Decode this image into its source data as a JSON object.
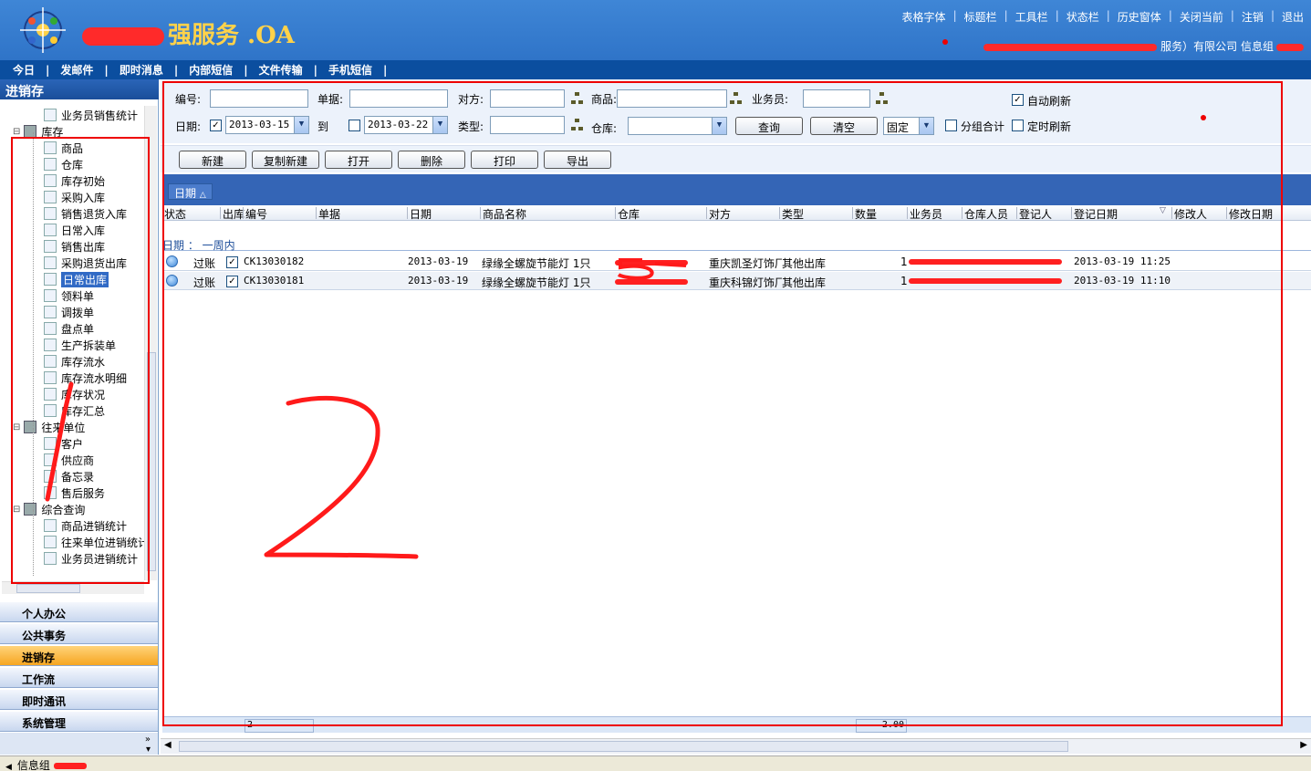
{
  "header": {
    "brand_text": "强服务 .OA",
    "top_links": [
      "表格字体",
      "标题栏",
      "工具栏",
      "状态栏",
      "历史窗体",
      "关闭当前",
      "注销",
      "退出"
    ],
    "company_text": "服务）有限公司",
    "user_group": "信息组"
  },
  "menu": [
    "今日",
    "发邮件",
    "即时消息",
    "内部短信",
    "文件传输",
    "手机短信"
  ],
  "left_panel": {
    "title": "进销存",
    "tree": [
      {
        "label": "业务员销售统计",
        "icon": "report-icon",
        "level": 2
      },
      {
        "label": "库存",
        "icon": "folder-icon",
        "level": 1
      },
      {
        "label": "商品",
        "icon": "box-icon",
        "level": 2
      },
      {
        "label": "仓库",
        "icon": "house-icon",
        "level": 2
      },
      {
        "label": "库存初始",
        "icon": "doc-icon",
        "level": 2
      },
      {
        "label": "采购入库",
        "icon": "doc-icon",
        "level": 2
      },
      {
        "label": "销售退货入库",
        "icon": "doc-icon",
        "level": 2
      },
      {
        "label": "日常入库",
        "icon": "doc-icon",
        "level": 2
      },
      {
        "label": "销售出库",
        "icon": "doc-icon",
        "level": 2
      },
      {
        "label": "采购退货出库",
        "icon": "doc-icon",
        "level": 2
      },
      {
        "label": "日常出库",
        "icon": "house-icon",
        "level": 2,
        "selected": true
      },
      {
        "label": "领料单",
        "icon": "house-icon",
        "level": 2
      },
      {
        "label": "调拨单",
        "icon": "house-icon",
        "level": 2
      },
      {
        "label": "盘点单",
        "icon": "check-icon",
        "level": 2
      },
      {
        "label": "生产拆装单",
        "icon": "house-icon",
        "level": 2
      },
      {
        "label": "库存流水",
        "icon": "house-icon",
        "level": 2
      },
      {
        "label": "库存流水明细",
        "icon": "house-icon",
        "level": 2
      },
      {
        "label": "库存状况",
        "icon": "chart-icon",
        "level": 2
      },
      {
        "label": "库存汇总",
        "icon": "chart-icon",
        "level": 2
      },
      {
        "label": "往来单位",
        "icon": "folder-icon",
        "level": 1
      },
      {
        "label": "客户",
        "icon": "person-icon",
        "level": 2
      },
      {
        "label": "供应商",
        "icon": "person-icon",
        "level": 2
      },
      {
        "label": "备忘录",
        "icon": "memo-icon",
        "level": 2
      },
      {
        "label": "售后服务",
        "icon": "service-icon",
        "level": 2
      },
      {
        "label": "综合查询",
        "icon": "folder-icon",
        "level": 1
      },
      {
        "label": "商品进销统计",
        "icon": "report-icon",
        "level": 2
      },
      {
        "label": "往来单位进销统计",
        "icon": "report-icon",
        "level": 2
      },
      {
        "label": "业务员进销统计",
        "icon": "report-icon",
        "level": 2
      }
    ],
    "nav_buttons": [
      {
        "label": "个人办公"
      },
      {
        "label": "公共事务"
      },
      {
        "label": "进销存",
        "active": true
      },
      {
        "label": "工作流"
      },
      {
        "label": "即时通讯"
      },
      {
        "label": "系统管理"
      }
    ]
  },
  "filters": {
    "no_label": "编号:",
    "doc_label": "单据:",
    "party_label": "对方:",
    "goods_label": "商品:",
    "salesman_label": "业务员:",
    "auto_refresh_label": "自动刷新",
    "auto_refresh_checked": true,
    "date_label": "日期:",
    "date_from_checked": true,
    "date_from": "2013-03-15",
    "to_label": "到",
    "date_to_checked": false,
    "date_to": "2013-03-22",
    "type_label": "类型:",
    "warehouse_label": "仓库:",
    "query_button": "查询",
    "clear_button": "清空",
    "mode_value": "固定",
    "group_total_label": "分组合计",
    "group_total_checked": false,
    "timed_refresh_label": "定时刷新",
    "timed_refresh_checked": false
  },
  "toolbar": [
    "新建",
    "复制新建",
    "打开",
    "删除",
    "打印",
    "导出"
  ],
  "grid": {
    "group_chip": "日期",
    "columns": [
      "状态",
      "出库",
      "编号",
      "单据",
      "日期",
      "商品名称",
      "仓库",
      "对方",
      "类型",
      "数量",
      "业务员",
      "仓库人员",
      "登记人",
      "登记日期",
      "修改人",
      "修改日期"
    ],
    "group_row": "日期 ： 一周内",
    "rows": [
      {
        "status": "过账",
        "out": true,
        "no": "CK13030182",
        "date": "2013-03-19",
        "goods": "绿缘全螺旋节能灯 1只",
        "party": "重庆凯圣灯饰厂",
        "type": "其他出库",
        "qty": "1",
        "reg_date": "2013-03-19 11:25"
      },
      {
        "status": "过账",
        "out": true,
        "no": "CK13030181",
        "date": "2013-03-19",
        "goods": "绿缘全螺旋节能灯 1只",
        "party": "重庆科锦灯饰厂",
        "type": "其他出库",
        "qty": "1",
        "reg_date": "2013-03-19 11:10"
      }
    ],
    "footer_count": "2",
    "footer_sum": "2.00"
  },
  "annotations": {
    "box1_number": "1",
    "box2_number": "2"
  },
  "statusbar": {
    "text": "信息组"
  },
  "colors": {
    "header_blue": "#3f86d6",
    "menu_blue": "#0b4e9f",
    "grid_group_blue": "#3465b6",
    "nav_active": "#f6a621",
    "annotation_red": "#e00000"
  }
}
